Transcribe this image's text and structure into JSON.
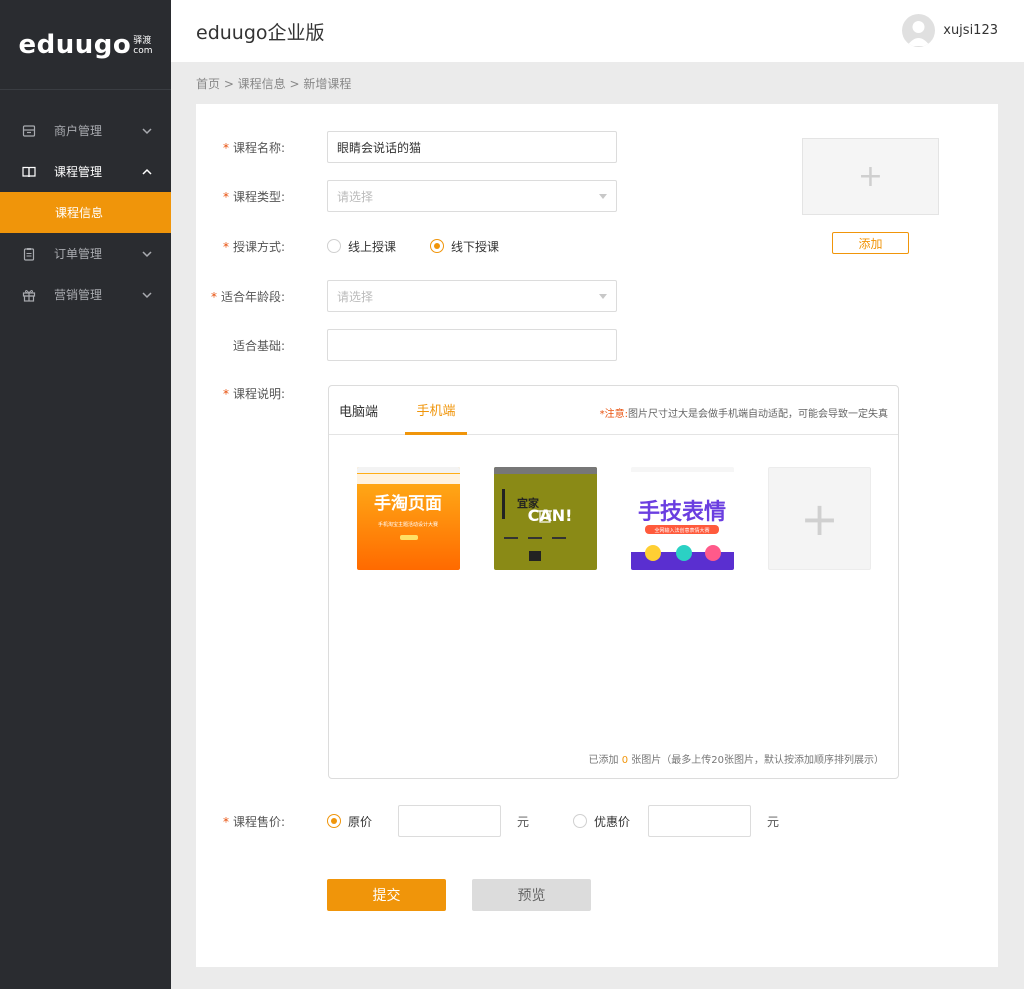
{
  "brand": {
    "logo_main": "eduugo",
    "logo_side_top": "驿渡",
    "logo_side_bottom": "com"
  },
  "sidebar": {
    "items": [
      {
        "label": "商户管理",
        "icon": "store-icon"
      },
      {
        "label": "课程管理",
        "icon": "book-icon"
      },
      {
        "label": "订单管理",
        "icon": "clipboard-icon"
      },
      {
        "label": "营销管理",
        "icon": "gift-icon"
      }
    ],
    "sub_item": "课程信息"
  },
  "header": {
    "title": "eduugo企业版",
    "username": "xujsi123"
  },
  "breadcrumb": "首页 > 课程信息 > 新增课程",
  "form": {
    "name": {
      "label": "课程名称:",
      "value": "眼睛会说话的猫"
    },
    "type": {
      "label": "课程类型:",
      "placeholder": "请选择"
    },
    "mode": {
      "label": "授课方式:",
      "options": [
        "线上授课",
        "线下授课"
      ],
      "selected": "线下授课"
    },
    "age": {
      "label": "适合年龄段:",
      "placeholder": "请选择"
    },
    "basis": {
      "label": "适合基础:",
      "value": ""
    },
    "desc": {
      "label": "课程说明:"
    },
    "price": {
      "label": "课程售价:",
      "original": "原价",
      "discount": "优惠价",
      "unit": "元"
    }
  },
  "cover": {
    "add_label": "添加"
  },
  "desc_box": {
    "tabs": [
      "电脑端",
      "手机端"
    ],
    "active_tab": "手机端",
    "note_star": "*注意:",
    "note_text": "图片尺寸过大是会做手机端自动适配，可能会导致一定失真",
    "count_prefix": "已添加",
    "count": "0",
    "count_suffix": "张图片（最多上传20张图片，默认按添加顺序排列展示）",
    "thumb_texts": [
      "手淘页面",
      "手机淘宝主题活动设计大赛",
      "宜家",
      "CAN!",
      "手技表情",
      "全网输入法创意表情大赛"
    ]
  },
  "actions": {
    "submit": "提交",
    "preview": "预览"
  },
  "colors": {
    "accent": "#f0950a",
    "sidebar": "#2a2c30"
  }
}
